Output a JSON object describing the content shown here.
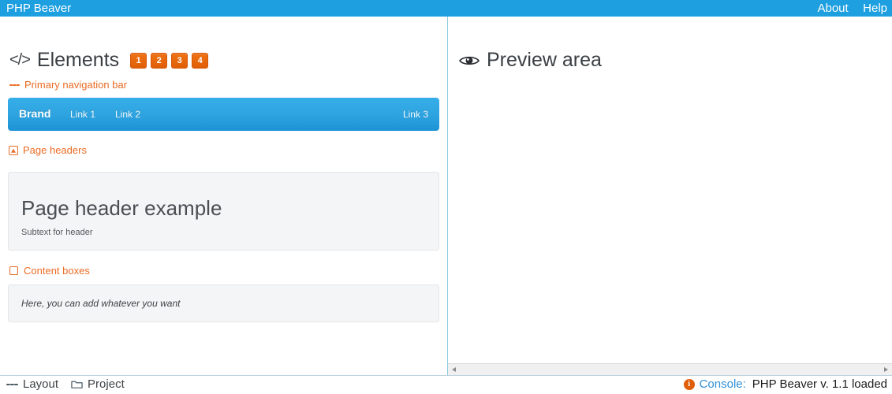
{
  "topbar": {
    "title": "PHP Beaver",
    "links": [
      {
        "label": "About",
        "name": "about-link"
      },
      {
        "label": "Help",
        "name": "help-link"
      }
    ]
  },
  "left_pane": {
    "heading": {
      "icon": "code-icon",
      "text": "Elements"
    },
    "badges": [
      "1",
      "2",
      "3",
      "4"
    ],
    "sections": [
      {
        "icon": "hamburger-icon",
        "label": "Primary navigation bar"
      },
      {
        "icon": "page-header-icon",
        "label": "Page headers"
      },
      {
        "icon": "content-box-icon",
        "label": "Content boxes"
      }
    ],
    "navbar_widget": {
      "brand": "Brand",
      "link1": "Link 1",
      "link2": "Link 2",
      "link3": "Link 3"
    },
    "page_header_widget": {
      "title": "Page header example",
      "subtext": "Subtext for header"
    },
    "content_box_widget": {
      "text": "Here, you can add whatever you want"
    }
  },
  "right_pane": {
    "heading": {
      "icon": "eye-icon",
      "text": "Preview area"
    }
  },
  "statusbar": {
    "tabs": [
      {
        "label": "Layout",
        "icon": "hamburger-icon"
      },
      {
        "label": "Project",
        "icon": "folder-icon"
      }
    ],
    "console": {
      "icon": "info-icon",
      "label": "Console:",
      "message": "PHP Beaver v. 1.1 loaded"
    }
  },
  "colors": {
    "topbar_blue": "#1d9fe0",
    "accent_orange": "#eb6c25",
    "badge_orange": "#e05e06",
    "navbar_blue": "#2fa4e0",
    "widget_gray": "#f4f5f6",
    "console_blue": "#2f8fd6",
    "divider_blue": "#8ec9e2"
  }
}
